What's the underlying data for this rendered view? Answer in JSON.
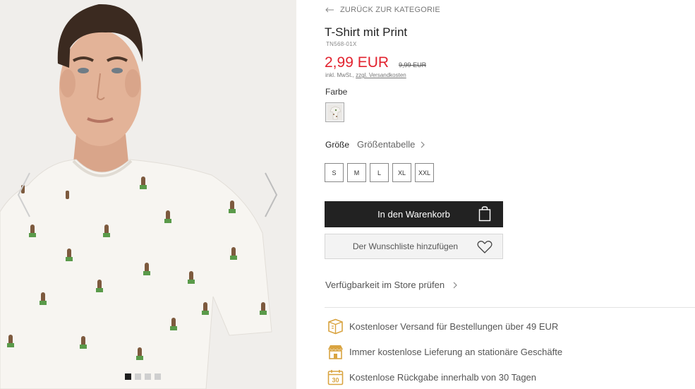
{
  "gallery": {
    "slides": [
      "slide-1",
      "slide-2",
      "slide-3",
      "slide-4"
    ],
    "active_slide": 1
  },
  "product": {
    "back_label": "ZURÜCK ZUR KATEGORIE",
    "title": "T-Shirt mit Print",
    "sku": "TN568-01X",
    "price": "2,99 EUR",
    "old_price": "9,99 EUR",
    "tax_note": "inkl. MwSt.,",
    "shipping_link": "zzgl. Versandkosten",
    "color_label": "Farbe",
    "size_label": "Größe",
    "size_table_label": "Größentabelle",
    "sizes": [
      "S",
      "M",
      "L",
      "XL",
      "XXL"
    ],
    "cart_label": "In den Warenkorb",
    "wishlist_label": "Der Wunschliste hinzufügen",
    "store_check_label": "Verfügbarkeit im Store prüfen"
  },
  "benefits": [
    {
      "icon": "shipping-box-icon",
      "text": "Kostenloser Versand für Bestellungen über 49 EUR"
    },
    {
      "icon": "store-icon",
      "text": "Immer kostenlose Lieferung an stationäre Geschäfte"
    },
    {
      "icon": "calendar-30-icon",
      "text": "Kostenlose Rückgabe innerhalb von 30 Tagen"
    }
  ],
  "calendar_icon_number": "30",
  "colors": {
    "price": "#e2232f",
    "button_dark": "#222222",
    "benefit_icon": "#d9a441"
  }
}
